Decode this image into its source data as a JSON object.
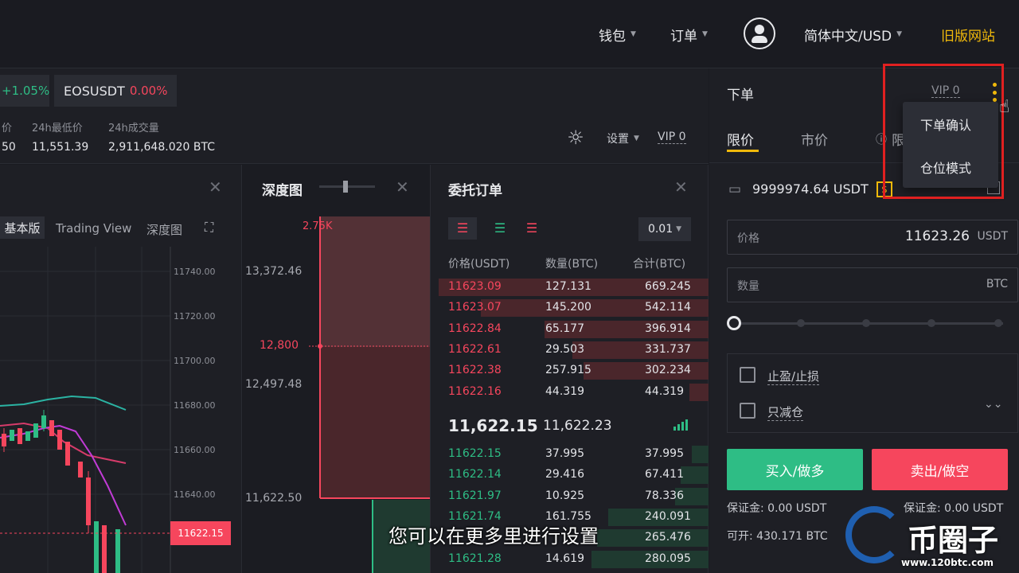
{
  "nav": {
    "wallet": "钱包",
    "orders": "订单",
    "language": "简体中文/USD",
    "legacy": "旧版网站"
  },
  "tickers": [
    {
      "change": "+1.05%"
    },
    {
      "symbol": "EOSUSDT",
      "change": "0.00%"
    }
  ],
  "stats": {
    "price_label_partial": "价",
    "price_value_partial": "50",
    "low_label": "24h最低价",
    "low_value": "11,551.39",
    "volume_label": "24h成交量",
    "volume_value": "2,911,648.020 BTC"
  },
  "toolbar": {
    "settings": "设置",
    "vip": "VIP 0"
  },
  "chart_panel": {
    "tabs": [
      "基本版",
      "Trading View",
      "深度图"
    ],
    "y_ticks": [
      "11740.00",
      "11720.00",
      "11700.00",
      "11680.00",
      "11660.00",
      "11640.00"
    ],
    "current_price": "11622.15"
  },
  "depth_panel": {
    "title": "深度图",
    "top_label": "2.75K",
    "y_labels": [
      "13,372.46",
      "12,800",
      "12,497.48",
      "11,622.50"
    ]
  },
  "orderbook": {
    "title": "委托订单",
    "precision": "0.01",
    "headers": [
      "价格(USDT)",
      "数量(BTC)",
      "合计(BTC)"
    ],
    "asks": [
      {
        "price": "11623.09",
        "qty": "127.131",
        "total": "669.245",
        "depth": 0.97
      },
      {
        "price": "11623.07",
        "qty": "145.200",
        "total": "542.114",
        "depth": 0.82
      },
      {
        "price": "11622.84",
        "qty": "65.177",
        "total": "396.914",
        "depth": 0.59
      },
      {
        "price": "11622.61",
        "qty": "29.503",
        "total": "331.737",
        "depth": 0.49
      },
      {
        "price": "11622.38",
        "qty": "257.915",
        "total": "302.234",
        "depth": 0.45
      },
      {
        "price": "11622.16",
        "qty": "44.319",
        "total": "44.319",
        "depth": 0.07
      }
    ],
    "last_price": "11,622.15",
    "mark_price": "11,622.23",
    "bids": [
      {
        "price": "11622.15",
        "qty": "37.995",
        "total": "37.995",
        "depth": 0.06
      },
      {
        "price": "11622.14",
        "qty": "29.416",
        "total": "67.411",
        "depth": 0.1
      },
      {
        "price": "11621.97",
        "qty": "10.925",
        "total": "78.336",
        "depth": 0.12
      },
      {
        "price": "11621.74",
        "qty": "161.755",
        "total": "240.091",
        "depth": 0.36
      },
      {
        "price": "",
        "qty": "",
        "total": "265.476",
        "depth": 0.4
      },
      {
        "price": "11621.28",
        "qty": "14.619",
        "total": "280.095",
        "depth": 0.42
      }
    ]
  },
  "order_form": {
    "title": "下单",
    "vip": "VIP 0",
    "tabs": [
      "限价",
      "市价",
      "限"
    ],
    "balance": "9999974.64 USDT",
    "price_label": "价格",
    "price_value": "11623.26",
    "price_unit": "USDT",
    "qty_label": "数量",
    "qty_unit": "BTC",
    "tp_sl": "止盈/止损",
    "reduce_only": "只减仓",
    "buy": "买入/做多",
    "sell": "卖出/做空",
    "margin_buy": "保证金: 0.00 USDT",
    "margin_sell": "保证金: 0.00 USDT",
    "available": "可开: 430.171 BTC"
  },
  "dropdown": {
    "items": [
      "下单确认",
      "仓位模式"
    ]
  },
  "subtitle": "您可以在更多里进行设置",
  "watermark": {
    "brand": "币圈子",
    "url": "www.120btc.com"
  },
  "colors": {
    "green": "#2ebd85",
    "red": "#f6465d",
    "accent": "#f0b90b"
  }
}
